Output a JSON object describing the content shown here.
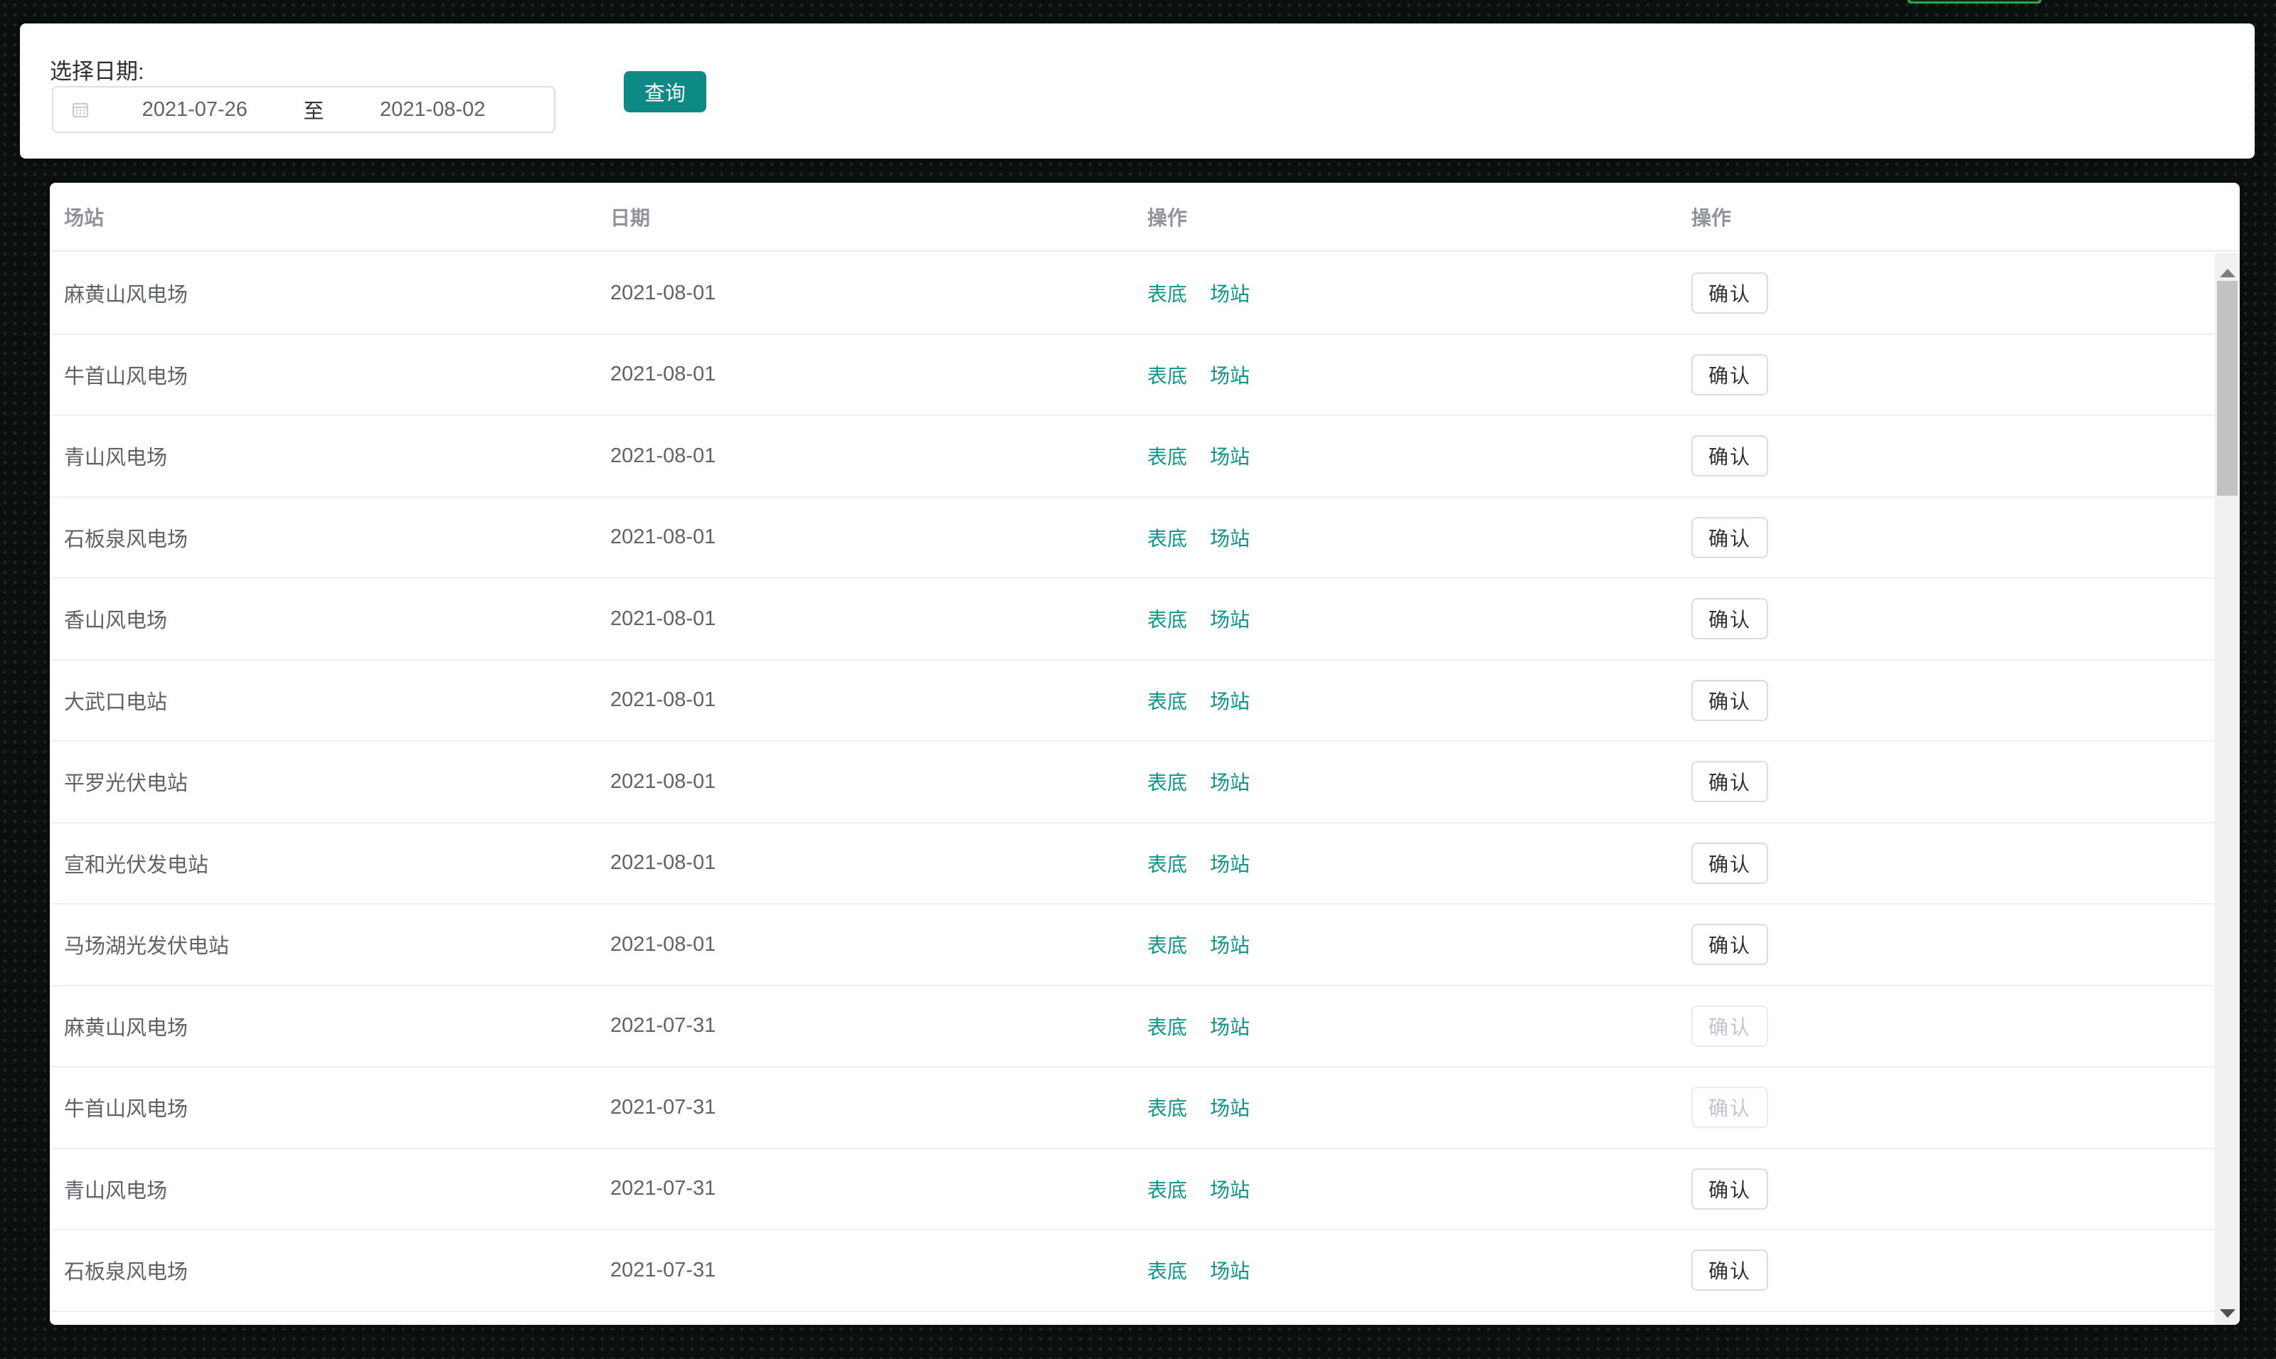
{
  "page": {
    "top_indicator_color": "#27a84b",
    "accent_teal": "#0c8a83",
    "link_teal": "#0f9489"
  },
  "filter_panel": {
    "date_label": "选择日期:",
    "calendar_icon": "calendar-icon",
    "date_start": "2021-07-26",
    "date_separator": "至",
    "date_end": "2021-08-02",
    "query_button_label": "查询"
  },
  "table": {
    "headers": {
      "station": "场站",
      "date": "日期",
      "ops1": "操作",
      "ops2": "操作"
    },
    "link_labels": {
      "sheet": "表底",
      "station": "场站"
    },
    "confirm_label": "确认",
    "rows": [
      {
        "station": "麻黄山风电场",
        "date": "2021-08-01",
        "confirm_enabled": true
      },
      {
        "station": "牛首山风电场",
        "date": "2021-08-01",
        "confirm_enabled": true
      },
      {
        "station": "青山风电场",
        "date": "2021-08-01",
        "confirm_enabled": true
      },
      {
        "station": "石板泉风电场",
        "date": "2021-08-01",
        "confirm_enabled": true
      },
      {
        "station": "香山风电场",
        "date": "2021-08-01",
        "confirm_enabled": true
      },
      {
        "station": "大武口电站",
        "date": "2021-08-01",
        "confirm_enabled": true
      },
      {
        "station": "平罗光伏电站",
        "date": "2021-08-01",
        "confirm_enabled": true
      },
      {
        "station": "宣和光伏发电站",
        "date": "2021-08-01",
        "confirm_enabled": true
      },
      {
        "station": "马场湖光发伏电站",
        "date": "2021-08-01",
        "confirm_enabled": true
      },
      {
        "station": "麻黄山风电场",
        "date": "2021-07-31",
        "confirm_enabled": false
      },
      {
        "station": "牛首山风电场",
        "date": "2021-07-31",
        "confirm_enabled": false
      },
      {
        "station": "青山风电场",
        "date": "2021-07-31",
        "confirm_enabled": true
      },
      {
        "station": "石板泉风电场",
        "date": "2021-07-31",
        "confirm_enabled": true
      }
    ]
  }
}
